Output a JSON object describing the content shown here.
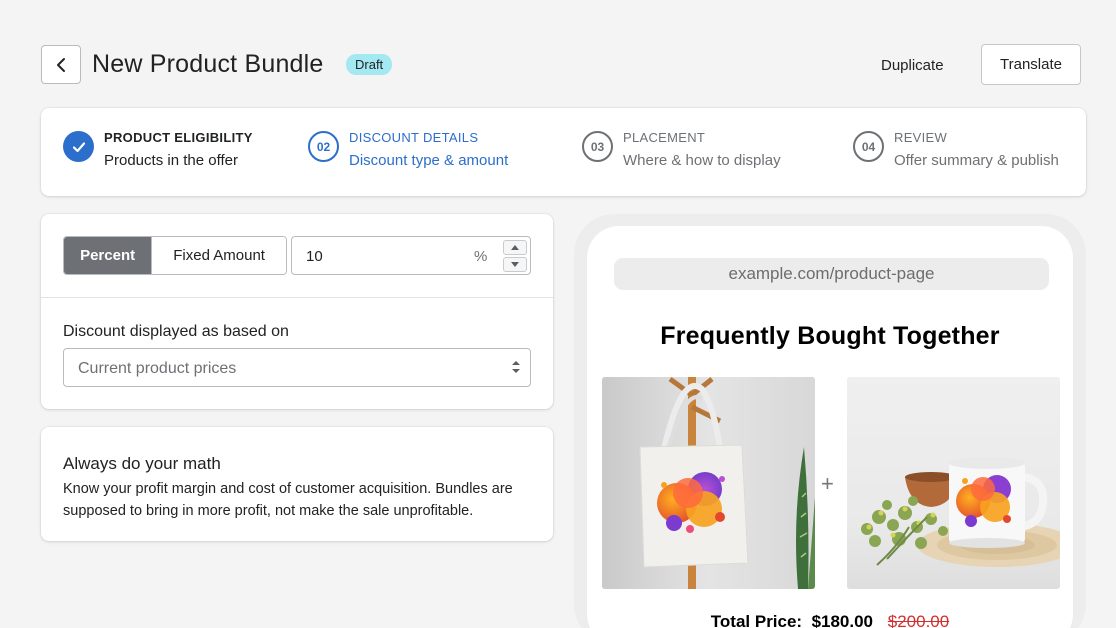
{
  "header": {
    "title": "New Product Bundle",
    "badge": "Draft",
    "duplicate_label": "Duplicate",
    "translate_label": "Translate"
  },
  "steps": [
    {
      "title": "PRODUCT ELIGIBILITY",
      "subtitle": "Products in the offer",
      "state": "done"
    },
    {
      "number": "02",
      "title": "DISCOUNT DETAILS",
      "subtitle": "Discount type & amount",
      "state": "active"
    },
    {
      "number": "03",
      "title": "PLACEMENT",
      "subtitle": "Where & how to display",
      "state": "todo"
    },
    {
      "number": "04",
      "title": "REVIEW",
      "subtitle": "Offer summary & publish",
      "state": "todo"
    }
  ],
  "discount": {
    "percent_label": "Percent",
    "fixed_label": "Fixed Amount",
    "selected": "Percent",
    "amount_value": "10",
    "amount_suffix": "%",
    "based_on_label": "Discount displayed as based on",
    "based_on_value": "Current product prices"
  },
  "tip": {
    "title": "Always do your math",
    "body": "Know your profit margin and cost of customer acquisition. Bundles are supposed to bring in more profit, not make the sale unprofitable."
  },
  "preview": {
    "url": "example.com/product-page",
    "title": "Frequently Bought Together",
    "plus": "+",
    "total_label": "Total Price:",
    "total_price": "$180.00",
    "original_price": "$200.00"
  },
  "colors": {
    "accent": "#2c6ecb",
    "badge": "#a4e8f2",
    "selected_segment": "#6d7175",
    "strike_price": "#d32f2f"
  }
}
